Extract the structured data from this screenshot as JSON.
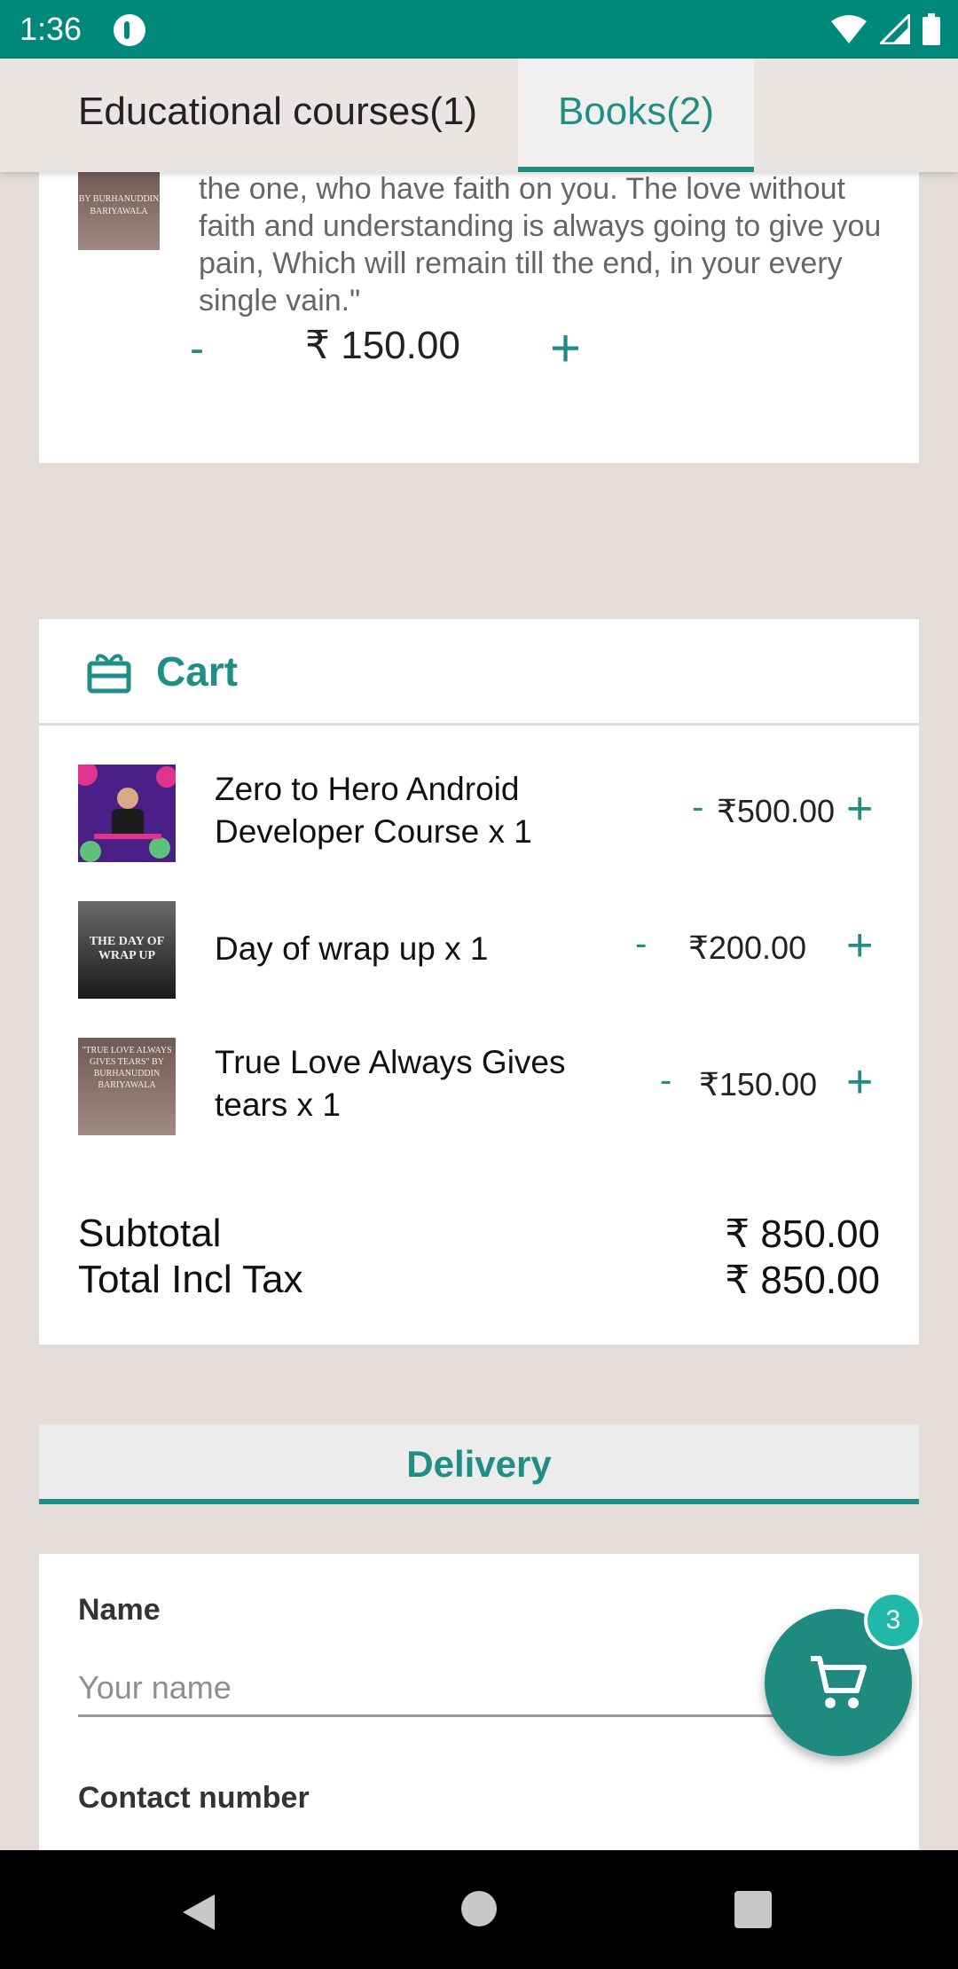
{
  "status_bar": {
    "time": "1:36"
  },
  "tabs": [
    {
      "label": "Educational courses(1)"
    },
    {
      "label": "Books(2)"
    }
  ],
  "book_card": {
    "thumb_text": "BY BURHANUDDIN BARIYAWALA",
    "description": "the one, who have faith on you. The love without faith and understanding is always going to give you pain, Which will remain till the end, in your every single vain.\"",
    "minus": "-",
    "price": "₹ 150.00",
    "plus": "+"
  },
  "cart": {
    "title": "Cart",
    "items": [
      {
        "name": "Zero to Hero Android Developer Course x 1",
        "minus": "-",
        "price": "₹500.00",
        "plus": "+"
      },
      {
        "name": "Day of wrap up x 1",
        "minus": "-",
        "price": "₹200.00",
        "plus": "+",
        "thumb_text": "THE DAY OF WRAP UP"
      },
      {
        "name": "True Love Always Gives tears x 1",
        "minus": "-",
        "price": "₹150.00",
        "plus": "+",
        "thumb_text": "\"TRUE LOVE ALWAYS GIVES TEARS\" BY BURHANUDDIN BARIYAWALA"
      }
    ],
    "subtotal_label": "Subtotal",
    "subtotal_value": "₹ 850.00",
    "total_label": "Total Incl Tax",
    "total_value": "₹ 850.00"
  },
  "delivery": {
    "tab_label": "Delivery"
  },
  "form": {
    "name_label": "Name",
    "name_placeholder": "Your name",
    "contact_label": "Contact number"
  },
  "fab": {
    "badge_count": "3"
  },
  "colors": {
    "accent": "#1f8f86",
    "status_bar": "#00897b",
    "background": "#e4dcd8"
  },
  "icons": [
    "wifi-icon",
    "signal-icon",
    "battery-icon",
    "gift-icon",
    "cart-icon",
    "back-icon",
    "home-icon",
    "recent-apps-icon"
  ]
}
